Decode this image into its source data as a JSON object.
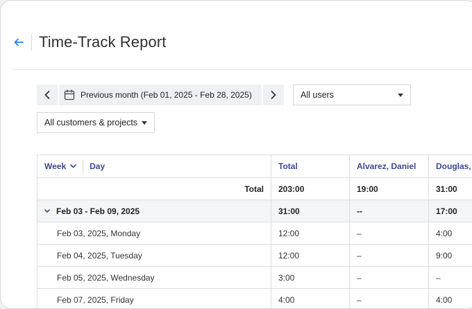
{
  "header": {
    "title": "Time-Track Report",
    "back_icon": "arrow-left-icon"
  },
  "filters": {
    "date_range": "Previous month (Feb 01, 2025 - Feb 28, 2025)",
    "users": "All users",
    "customers": "All customers & projects"
  },
  "table": {
    "headers": {
      "week": "Week",
      "day": "Day",
      "total": "Total",
      "col1": "Alvarez, Daniel",
      "col2": "Douglas,"
    },
    "total_row": {
      "label": "Total",
      "total": "203:00",
      "col1": "19:00",
      "col2": "31:00"
    },
    "week_row": {
      "label": "Feb 03 - Feb 09, 2025",
      "total": "31:00",
      "col1": "--",
      "col2": "17:00"
    },
    "days": [
      {
        "label": "Feb 03, 2025, Monday",
        "total": "12:00",
        "col1": "–",
        "col2": "4:00"
      },
      {
        "label": "Feb 04, 2025, Tuesday",
        "total": "12:00",
        "col1": "–",
        "col2": "9:00"
      },
      {
        "label": "Feb 05, 2025, Wednesday",
        "total": "3:00",
        "col1": "–",
        "col2": "–"
      },
      {
        "label": "Feb 07, 2025, Friday",
        "total": "4:00",
        "col1": "–",
        "col2": "4:00"
      }
    ]
  },
  "colors": {
    "accent": "#3b7ddd",
    "header_text": "#3b4a8c"
  }
}
